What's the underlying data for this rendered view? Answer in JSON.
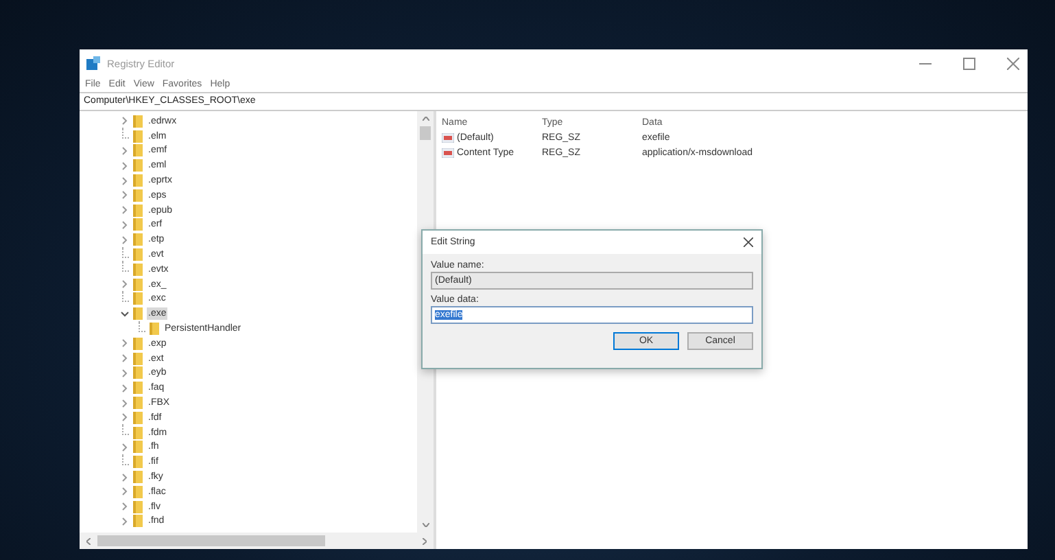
{
  "window": {
    "title": "Registry Editor"
  },
  "menu": [
    "File",
    "Edit",
    "View",
    "Favorites",
    "Help"
  ],
  "address": "Computer\\HKEY_CLASSES_ROOT\\exe",
  "tree": {
    "items": [
      {
        "label": ".edrwx",
        "kind": "collapsed",
        "selected": false
      },
      {
        "label": ".elm",
        "kind": "leaf",
        "selected": false
      },
      {
        "label": ".emf",
        "kind": "collapsed",
        "selected": false
      },
      {
        "label": ".eml",
        "kind": "collapsed",
        "selected": false
      },
      {
        "label": ".eprtx",
        "kind": "collapsed",
        "selected": false
      },
      {
        "label": ".eps",
        "kind": "collapsed",
        "selected": false
      },
      {
        "label": ".epub",
        "kind": "collapsed",
        "selected": false
      },
      {
        "label": ".erf",
        "kind": "collapsed",
        "selected": false
      },
      {
        "label": ".etp",
        "kind": "collapsed",
        "selected": false
      },
      {
        "label": ".evt",
        "kind": "leaf",
        "selected": false
      },
      {
        "label": ".evtx",
        "kind": "leaf",
        "selected": false
      },
      {
        "label": ".ex_",
        "kind": "collapsed",
        "selected": false
      },
      {
        "label": ".exc",
        "kind": "leaf",
        "selected": false
      },
      {
        "label": ".exe",
        "kind": "expanded",
        "selected": true,
        "children": [
          {
            "label": "PersistentHandler",
            "kind": "leaf",
            "selected": false
          }
        ]
      },
      {
        "label": ".exp",
        "kind": "collapsed",
        "selected": false
      },
      {
        "label": ".ext",
        "kind": "collapsed",
        "selected": false
      },
      {
        "label": ".eyb",
        "kind": "collapsed",
        "selected": false
      },
      {
        "label": ".faq",
        "kind": "collapsed",
        "selected": false
      },
      {
        "label": ".FBX",
        "kind": "collapsed",
        "selected": false
      },
      {
        "label": ".fdf",
        "kind": "collapsed",
        "selected": false
      },
      {
        "label": ".fdm",
        "kind": "leaf",
        "selected": false
      },
      {
        "label": ".fh",
        "kind": "collapsed",
        "selected": false
      },
      {
        "label": ".fif",
        "kind": "leaf",
        "selected": false
      },
      {
        "label": ".fky",
        "kind": "collapsed",
        "selected": false
      },
      {
        "label": ".flac",
        "kind": "collapsed",
        "selected": false
      },
      {
        "label": ".flv",
        "kind": "collapsed",
        "selected": false
      },
      {
        "label": ".fnd",
        "kind": "collapsed",
        "selected": false
      }
    ]
  },
  "values": {
    "columns": [
      "Name",
      "Type",
      "Data"
    ],
    "rows": [
      {
        "name": "(Default)",
        "type": "REG_SZ",
        "data": "exefile"
      },
      {
        "name": "Content Type",
        "type": "REG_SZ",
        "data": "application/x-msdownload"
      }
    ]
  },
  "dialog": {
    "title": "Edit String",
    "fields": [
      {
        "kind": "readonly",
        "label": "Value name:",
        "value": "(Default)",
        "text_selected": false
      },
      {
        "kind": "input",
        "label": "Value data:",
        "value": "exefile",
        "text_selected": true
      }
    ],
    "buttons": [
      {
        "label": "OK",
        "default": true
      },
      {
        "label": "Cancel",
        "default": false
      }
    ]
  }
}
